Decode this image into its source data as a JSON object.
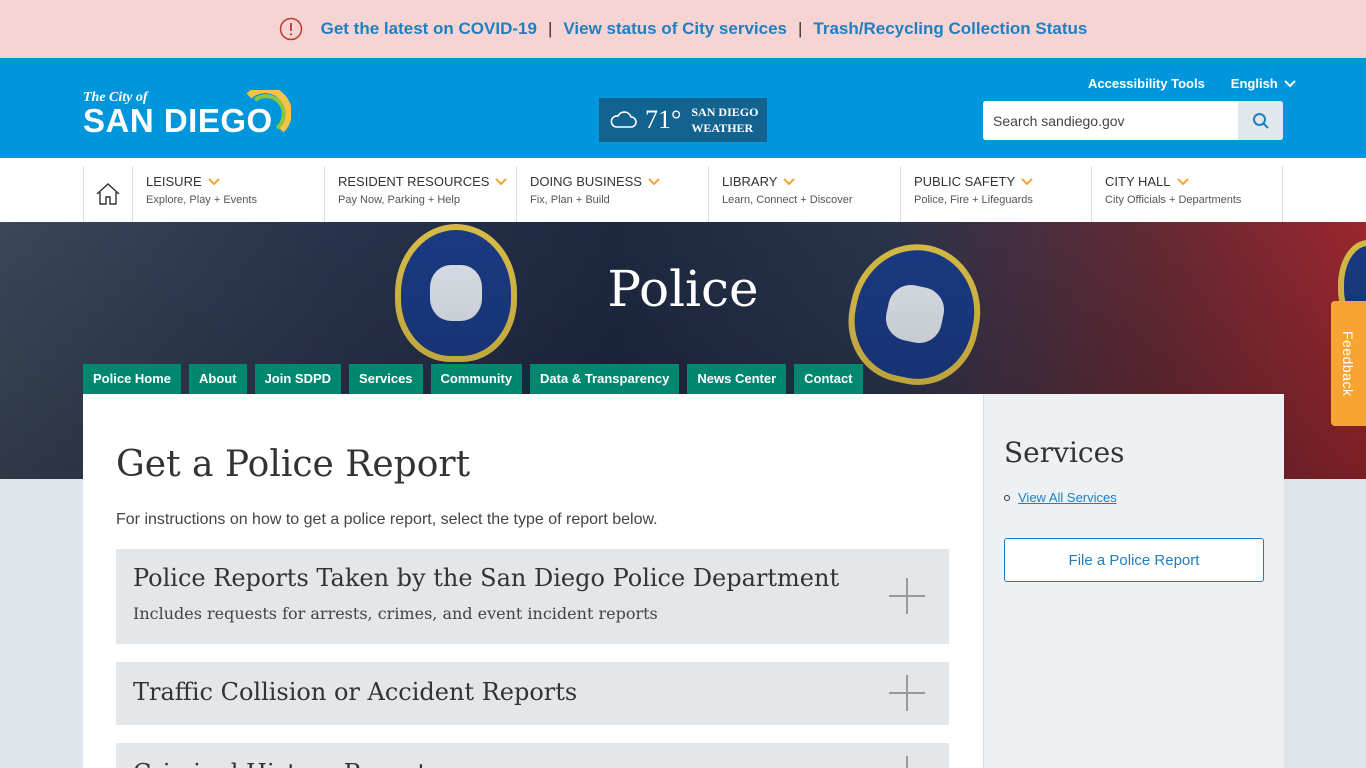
{
  "alert": {
    "links": [
      "Get the latest on COVID-19",
      "View status of City services",
      "Trash/Recycling Collection Status"
    ],
    "separator": "|"
  },
  "header": {
    "logo_small": "The City of",
    "logo_big": "SAN DIEGO",
    "weather_temp": "71°",
    "weather_label_1": "SAN DIEGO",
    "weather_label_2": "WEATHER",
    "accessibility": "Accessibility Tools",
    "language": "English",
    "search_placeholder": "Search sandiego.gov"
  },
  "nav": {
    "items": [
      {
        "title": "LEISURE",
        "sub": "Explore, Play + Events"
      },
      {
        "title": "RESIDENT RESOURCES",
        "sub": "Pay Now, Parking + Help"
      },
      {
        "title": "DOING BUSINESS",
        "sub": "Fix, Plan + Build"
      },
      {
        "title": "LIBRARY",
        "sub": "Learn, Connect + Discover"
      },
      {
        "title": "PUBLIC SAFETY",
        "sub": "Police, Fire + Lifeguards"
      },
      {
        "title": "CITY HALL",
        "sub": "City Officials + Departments"
      }
    ]
  },
  "hero": {
    "title": "Police",
    "subnav": [
      "Police Home",
      "About",
      "Join SDPD",
      "Services",
      "Community",
      "Data & Transparency",
      "News Center",
      "Contact"
    ]
  },
  "feedback": "Feedback",
  "main": {
    "title": "Get a Police Report",
    "intro": "For instructions on how to get a police report, select the type of report below.",
    "accordions": [
      {
        "title": "Police Reports Taken by the San Diego Police Department",
        "sub": "Includes requests for arrests, crimes, and event incident reports"
      },
      {
        "title": "Traffic Collision or Accident Reports",
        "sub": ""
      },
      {
        "title": "Criminal History Reports",
        "sub": ""
      }
    ]
  },
  "sidebar": {
    "title": "Services",
    "link": "View All Services",
    "button": "File a Police Report"
  },
  "colors": {
    "alert_bg": "#f7d4d4",
    "header_bg": "#0096db",
    "link": "#1f7fc0",
    "subnav_bg": "#00876f",
    "feedback_bg": "#f6a532",
    "nav_chevron": "#f6a532"
  },
  "icons": [
    "alert-icon",
    "cloud-icon",
    "chevron-down-icon",
    "search-icon",
    "home-icon",
    "plus-icon"
  ]
}
